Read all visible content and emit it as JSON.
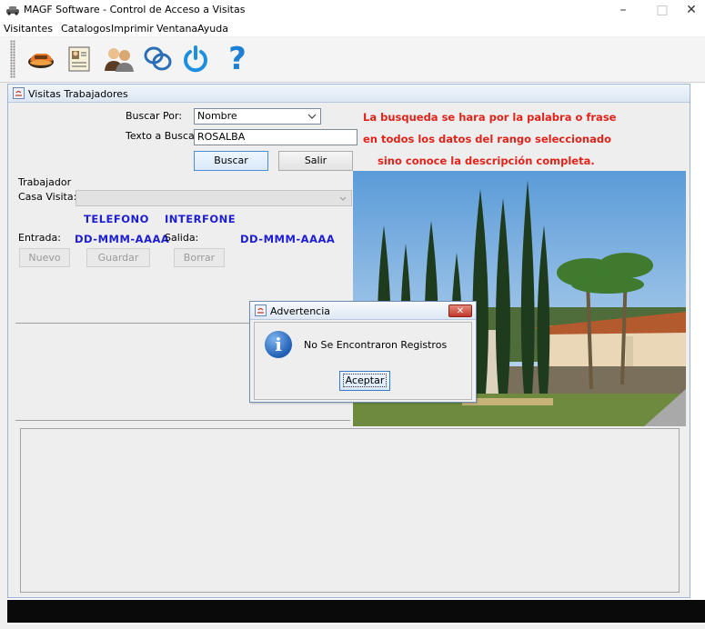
{
  "window": {
    "title": "MAGF Software - Control de Acceso a Visitas",
    "minimize": "–",
    "maximize": "□",
    "close": "✕"
  },
  "menubar": {
    "items": [
      "Visitantes",
      "Catalogos",
      "Imprimir",
      "Ventana",
      "Ayuda"
    ]
  },
  "toolbar": {
    "buttons": [
      "car-icon",
      "id-card-icon",
      "users-icon",
      "search-icon",
      "power-icon",
      "help-icon"
    ],
    "help_glyph": "?"
  },
  "frame": {
    "title": "Visitas Trabajadores",
    "buscar_por_label": "Buscar Por:",
    "buscar_por_value": "Nombre",
    "texto_label": "Texto a Buscar:",
    "texto_value": "ROSALBA",
    "buscar_button": "Buscar",
    "salir_button": "Salir",
    "info_lines": [
      "La busqueda se hara por la palabra o frase",
      "en todos los datos del rango seleccionado",
      "sino conoce la descripción completa."
    ],
    "trabajador_label": "Trabajador",
    "casa_visita_label": "Casa Visita:",
    "casa_visita_value": "",
    "telefono": "TELEFONO",
    "interfone": "INTERFONE",
    "entrada_label": "Entrada:",
    "entrada_value": "DD-MMM-AAAA",
    "salida_label": "Salida:",
    "salida_value": "DD-MMM-AAAA",
    "nuevo_button": "Nuevo",
    "guardar_button": "Guardar",
    "borrar_button": "Borrar"
  },
  "dialog": {
    "title": "Advertencia",
    "message": "No Se Encontraron Registros",
    "ok_button": "Aceptar",
    "close_glyph": "✕",
    "info_glyph": "i"
  },
  "colors": {
    "info_red": "#e2231a",
    "label_blue": "#1d1dd6"
  }
}
